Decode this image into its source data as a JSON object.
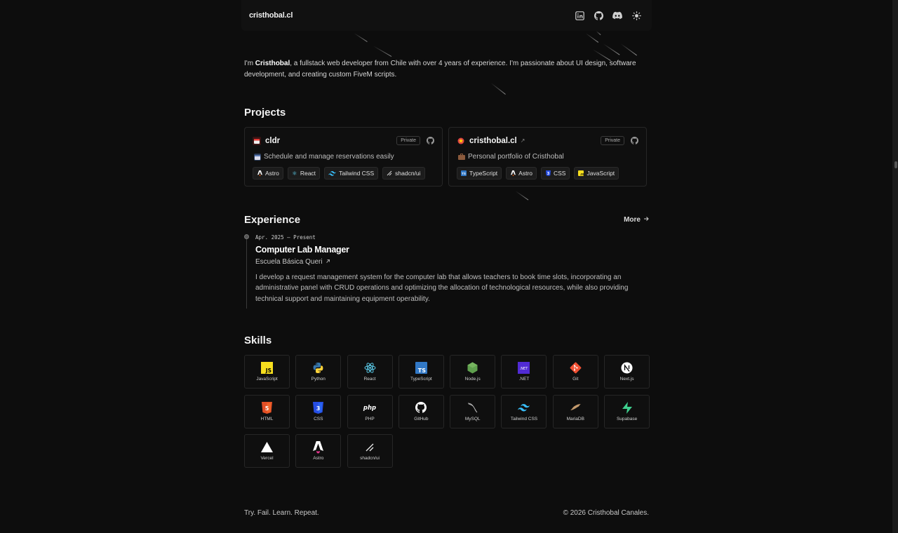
{
  "header": {
    "logo": "cristhobal.cl",
    "icons": [
      "linkedin-icon",
      "github-icon",
      "discord-icon",
      "sun-icon"
    ]
  },
  "intro": {
    "prefix": "I'm ",
    "name": "Cristhobal",
    "text": ", a fullstack web developer from Chile with over 4 years of experience. I'm passionate about UI design, software development, and creating custom FiveM scripts."
  },
  "projects": {
    "title": "Projects",
    "items": [
      {
        "name": "cldr",
        "badge": "Private",
        "description": "Schedule and manage reservations easily",
        "tags": [
          "Astro",
          "React",
          "Tailwind CSS",
          "shadcn/ui"
        ]
      },
      {
        "name": "cristhobal.cl",
        "external": "↗",
        "badge": "Private",
        "description": "Personal portfolio of Cristhobal",
        "tags": [
          "TypeScript",
          "Astro",
          "CSS",
          "JavaScript"
        ]
      }
    ]
  },
  "experience": {
    "title": "Experience",
    "more": "More",
    "items": [
      {
        "date": "Apr. 2025 — Present",
        "role": "Computer Lab Manager",
        "company": "Escuela Básica Queri",
        "description": "I develop a request management system for the computer lab that allows teachers to book time slots, incorporating an administrative panel with CRUD operations and optimizing the allocation of technological resources, while also providing technical support and maintaining equipment operability."
      }
    ]
  },
  "skills": {
    "title": "Skills",
    "items": [
      "JavaScript",
      "Python",
      "React",
      "TypeScript",
      "Node.js",
      ".NET",
      "Git",
      "Next.js",
      "HTML",
      "CSS",
      "PHP",
      "GitHub",
      "MySQL",
      "Tailwind CSS",
      "MariaDB",
      "Supabase",
      "Vercel",
      "Astro",
      "shadcn/ui"
    ]
  },
  "footer": {
    "motto": "Try. Fail. Learn. Repeat.",
    "copyright": "© 2026 Cristhobal Canales."
  }
}
